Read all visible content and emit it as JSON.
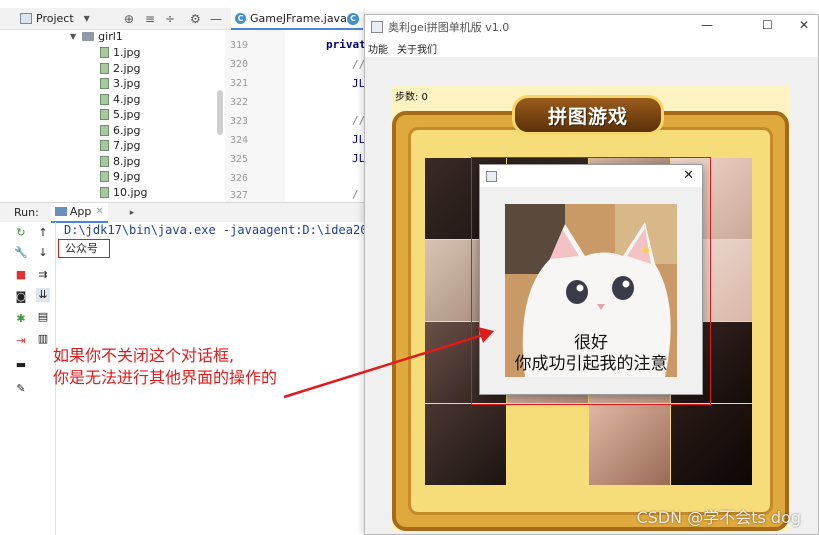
{
  "ide": {
    "project_label": "Project",
    "editor_tab": "GameJFrame.java",
    "tree": {
      "folder": "girl1",
      "files": [
        "1.jpg",
        "2.jpg",
        "3.jpg",
        "4.jpg",
        "5.jpg",
        "6.jpg",
        "7.jpg",
        "8.jpg",
        "9.jpg",
        "10.jpg"
      ]
    },
    "line_numbers": [
      "319",
      "320",
      "321",
      "322",
      "323",
      "324",
      "325",
      "326",
      "327"
    ],
    "code_fragments": [
      "privat",
      "//",
      "JL",
      "//",
      "JL",
      "JL",
      "/"
    ],
    "run": {
      "label": "Run:",
      "tab": "App",
      "console_command": "D:\\jdk17\\bin\\java.exe -javaagent:D:\\idea2022",
      "console_output": "公众号"
    }
  },
  "annotation": {
    "line1": "如果你不关闭这个对话框,",
    "line2": "你是无法进行其他界面的操作的"
  },
  "game_window": {
    "title": "奥利gei拼图单机版 v1.0",
    "menu": [
      "功能",
      "关于我们"
    ],
    "step_text": "步数: 0",
    "banner": "拼图游戏",
    "controls": {
      "minimize": "—",
      "maximize": "☐",
      "close": "✕"
    }
  },
  "dialog": {
    "close": "✕",
    "text_line1": "很好",
    "text_line2": "你成功引起我的注意"
  },
  "watermark": "CSDN @学不会ts dog",
  "colors": {
    "annotation_red": "#e01b1b",
    "console_blue": "#1f3fa0",
    "frame_gold": "#e0a93d"
  }
}
